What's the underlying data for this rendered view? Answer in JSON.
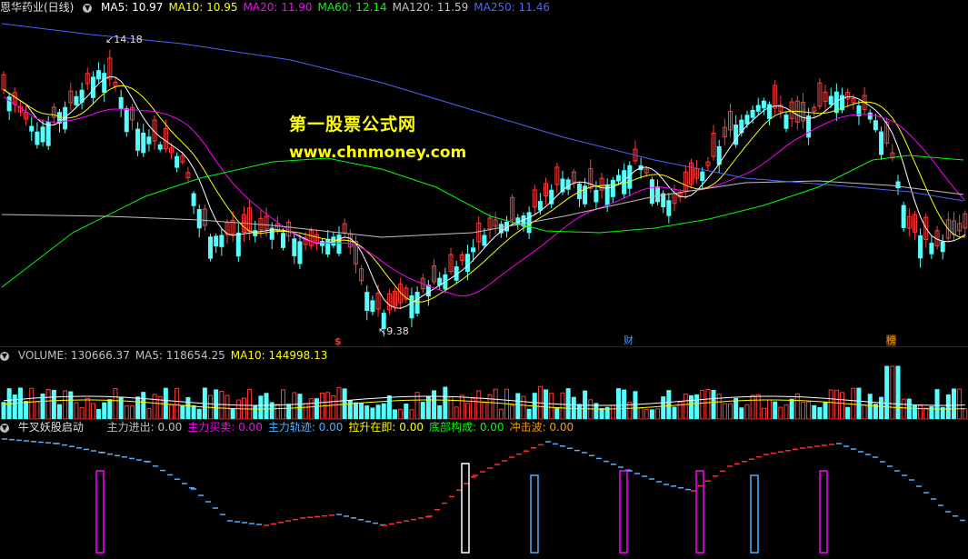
{
  "stock_name": "恩华药业(日线)",
  "price_indicators": [
    {
      "label": "MA5: 10.97",
      "color": "#ffffff"
    },
    {
      "label": "MA10: 10.95",
      "color": "#ffff00"
    },
    {
      "label": "MA20: 11.90",
      "color": "#ff00ff"
    },
    {
      "label": "MA60: 12.14",
      "color": "#00ff00"
    },
    {
      "label": "MA120: 11.59",
      "color": "#c0c0c0"
    },
    {
      "label": "MA250: 11.46",
      "color": "#4a64ff"
    }
  ],
  "price_high_label": "14.18",
  "price_low_label": "9.38",
  "watermark": {
    "title": "第一股票公式网",
    "url": "www.chnmoney.com"
  },
  "markers": [
    {
      "text": "$",
      "color": "#ff3030"
    },
    {
      "text": "财",
      "color": "#4a9bff"
    },
    {
      "text": "榜",
      "color": "#ff9900"
    }
  ],
  "volume_header": [
    {
      "label": "VOLUME: 130666.37",
      "color": "#c0c0c0"
    },
    {
      "label": "MA5: 118654.25",
      "color": "#c0c0c0"
    },
    {
      "label": "MA10: 144998.13",
      "color": "#ffff00"
    }
  ],
  "indicator_header": {
    "name": "牛叉妖股启动",
    "items": [
      {
        "label": "主力进出: 0.00",
        "color": "#c0c0c0"
      },
      {
        "label": "主力买卖: 0.00",
        "color": "#ff00ff"
      },
      {
        "label": "主力轨迹: 0.00",
        "color": "#4ab0ff"
      },
      {
        "label": "拉升在即: 0.00",
        "color": "#ffff00"
      },
      {
        "label": "底部构成: 0.00",
        "color": "#00ff00"
      },
      {
        "label": "冲击波: 0.00",
        "color": "#ff9900"
      }
    ]
  },
  "colors": {
    "up": "#ff3b3b",
    "down": "#54ffff",
    "ma5": "#ffffff",
    "ma10": "#ffff00",
    "ma20": "#ff00ff",
    "ma60": "#00ff00",
    "ma120": "#c0c0c0",
    "ma250": "#4a64ff",
    "separator": "#8b0000"
  }
}
